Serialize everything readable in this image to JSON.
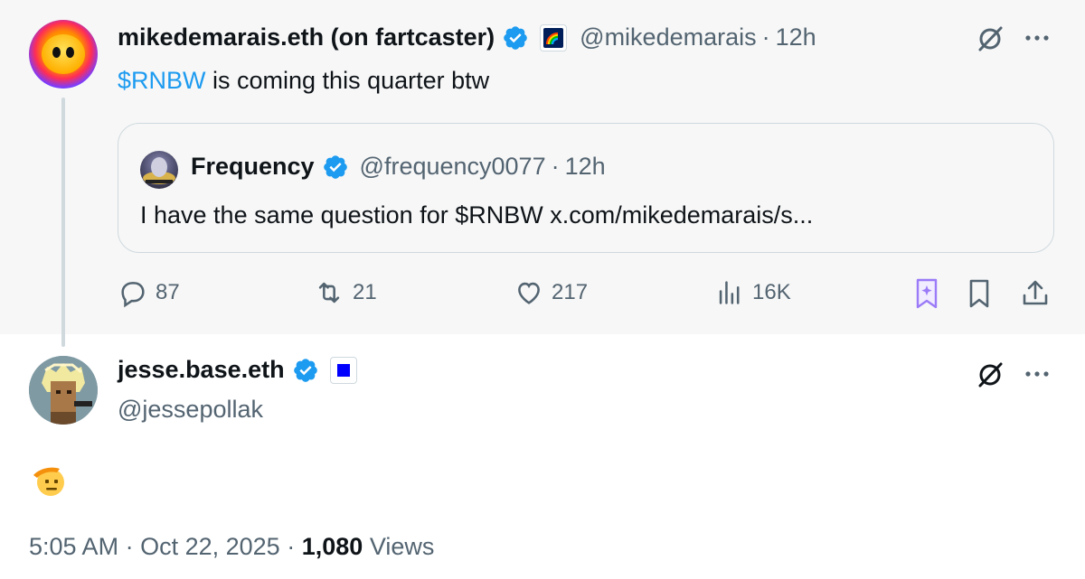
{
  "parent_tweet": {
    "display_name": "mikedemarais.eth (on fartcaster)",
    "handle": "@mikedemarais",
    "separator": "·",
    "time": "12h",
    "cashtag": "$RNBW",
    "text_rest": " is coming this quarter btw",
    "quote": {
      "display_name": "Frequency",
      "handle": "@frequency0077",
      "separator": "·",
      "time": "12h",
      "text": "I have the same question for $RNBW x.com/mikedemarais/s..."
    },
    "stats": {
      "replies": "87",
      "reposts": "21",
      "likes": "217",
      "views": "16K"
    }
  },
  "main_tweet": {
    "display_name": "jesse.base.eth",
    "handle": "@jessepollak",
    "body_emoji": "saluting-face-emoji",
    "time": "5:05 AM",
    "separator": "·",
    "date": "Oct 22, 2025",
    "views_count": "1,080",
    "views_label": "Views"
  },
  "colors": {
    "accent": "#1d9bf0",
    "text_primary": "#0f1419",
    "text_secondary": "#536471",
    "border": "#cfd9de",
    "grok_purple": "#9b7bf7"
  },
  "icons": [
    "verified-badge-icon",
    "rainbow-affiliate-icon",
    "grok-icon",
    "more-icon",
    "reply-icon",
    "repost-icon",
    "like-icon",
    "views-icon",
    "grok-bookmark-icon",
    "bookmark-icon",
    "share-icon",
    "base-affiliate-icon"
  ]
}
